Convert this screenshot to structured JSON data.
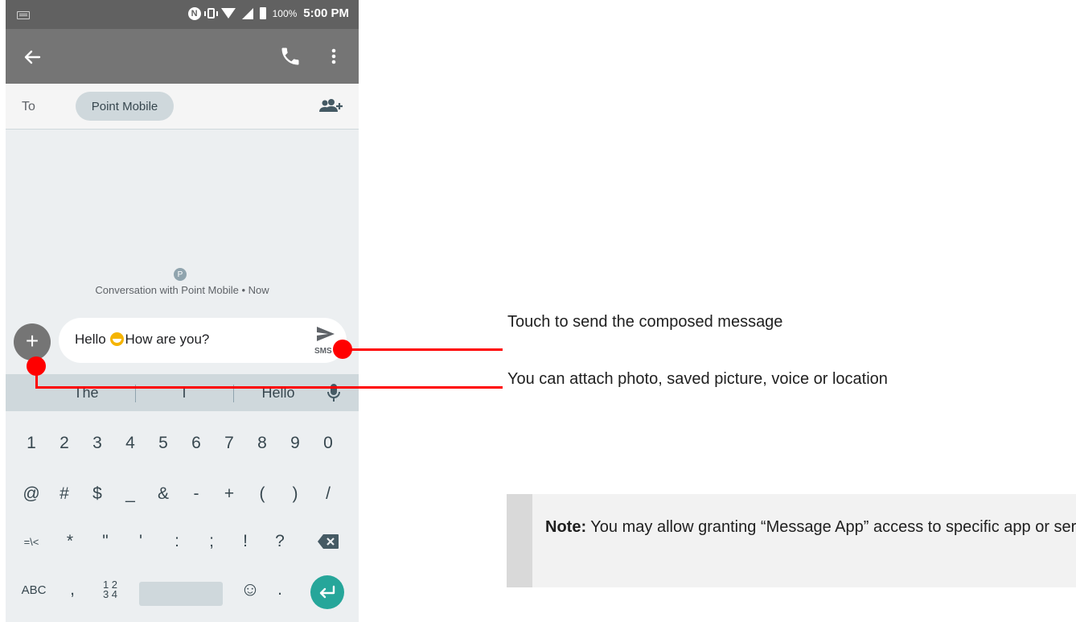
{
  "status_bar": {
    "nfc_icon": "N",
    "battery_pct": "100%",
    "time": "5:00 PM"
  },
  "compose_screen": {
    "to_label": "To",
    "recipient_chip": "Point Mobile",
    "conversation_avatar_letter": "P",
    "conversation_caption": "Conversation with Point Mobile • Now",
    "attach_label": "+",
    "message_before_emoji": "Hello ",
    "message_emoji": "grinning-face-emoji",
    "message_after_emoji": "How are you?",
    "send_label": "SMS"
  },
  "keyboard": {
    "suggestions": [
      "The",
      "I",
      "Hello"
    ],
    "row1": [
      "1",
      "2",
      "3",
      "4",
      "5",
      "6",
      "7",
      "8",
      "9",
      "0"
    ],
    "row2": [
      "@",
      "#",
      "$",
      "_",
      "&",
      "-",
      "+",
      "(",
      ")",
      "/"
    ],
    "row3": [
      "=\\<",
      "*",
      "\"",
      "'",
      ":",
      ";",
      "!",
      "?"
    ],
    "row4": {
      "abc": "ABC",
      "comma": ",",
      "numpad": "1 2\n3 4",
      "emoji": "☺",
      "period": "."
    }
  },
  "callouts": {
    "send": "Touch to send the composed message",
    "attach": "You can attach photo, saved picture, voice or location",
    "accent_color": "#ff0000"
  },
  "note": {
    "label": "Note:",
    "text": " You may allow granting “Message App” access to specific app or service."
  },
  "colors": {
    "status_bar": "#616161",
    "app_bar": "#757575",
    "enter_key": "#26a69a"
  },
  "icons": [
    "keyboard-indicator-icon",
    "nfc-icon",
    "vibrate-icon",
    "wifi-icon",
    "cell-signal-icon",
    "battery-icon",
    "back-arrow-icon",
    "phone-icon",
    "more-vert-icon",
    "add-people-icon",
    "plus-icon",
    "send-icon",
    "mic-icon",
    "backspace-icon",
    "emoji-icon",
    "enter-icon"
  ]
}
